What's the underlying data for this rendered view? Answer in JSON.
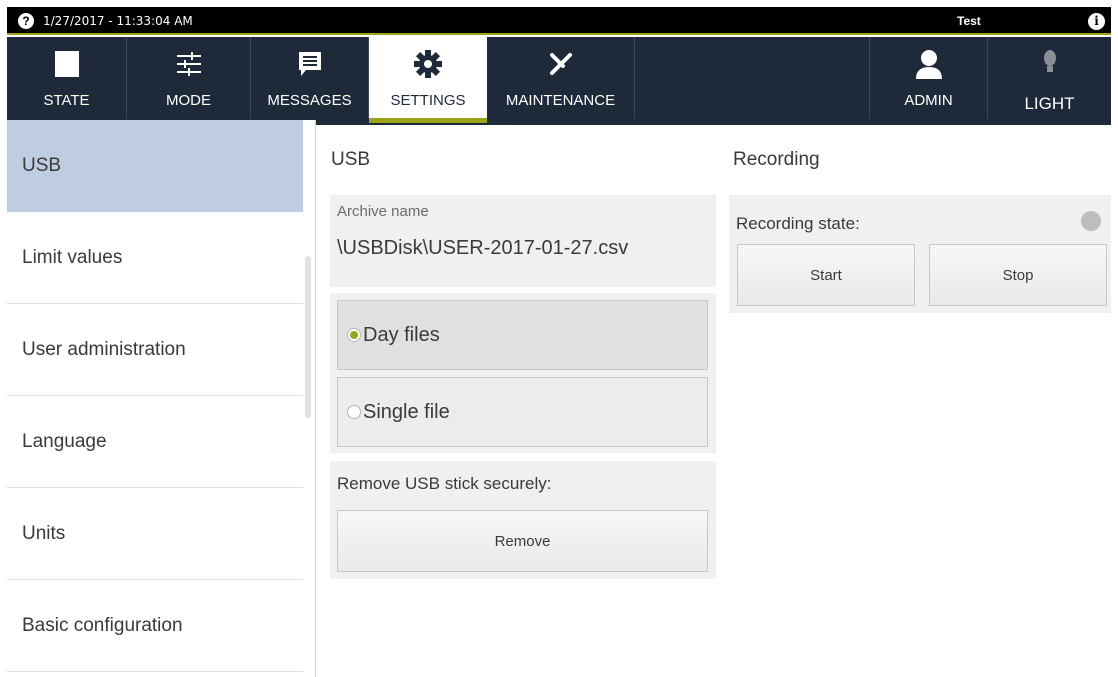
{
  "statusbar": {
    "help_icon": "?",
    "datetime": "1/27/2017 - 11:33:04 AM",
    "user": "Test",
    "info_icon": "i"
  },
  "nav": {
    "items": [
      {
        "label": "STATE",
        "icon": "square-icon"
      },
      {
        "label": "MODE",
        "icon": "sliders-icon"
      },
      {
        "label": "MESSAGES",
        "icon": "message-icon"
      },
      {
        "label": "SETTINGS",
        "icon": "gear-icon",
        "active": true
      },
      {
        "label": "MAINTENANCE",
        "icon": "tools-icon"
      }
    ],
    "right_items": [
      {
        "label": "ADMIN",
        "icon": "user-icon"
      },
      {
        "label": "LIGHT",
        "icon": "bulb-icon"
      }
    ]
  },
  "sidebar": {
    "items": [
      {
        "label": "USB",
        "active": true
      },
      {
        "label": "Limit values"
      },
      {
        "label": "User administration"
      },
      {
        "label": "Language"
      },
      {
        "label": "Units"
      },
      {
        "label": "Basic configuration"
      }
    ]
  },
  "usb": {
    "title": "USB",
    "archive_label": "Archive name",
    "archive_value": "\\USBDisk\\USER-2017-01-27.csv",
    "options": [
      {
        "label": "Day files",
        "selected": true
      },
      {
        "label": "Single file",
        "selected": false
      }
    ],
    "remove_label": "Remove USB stick securely:",
    "remove_button": "Remove"
  },
  "recording": {
    "title": "Recording",
    "state_label": "Recording state:",
    "state_led_color": "#bdbdbd",
    "start_button": "Start",
    "stop_button": "Stop"
  },
  "colors": {
    "accent": "#9aa51a",
    "navbar": "#1e2939",
    "sidebar_active": "#bfcde2"
  }
}
